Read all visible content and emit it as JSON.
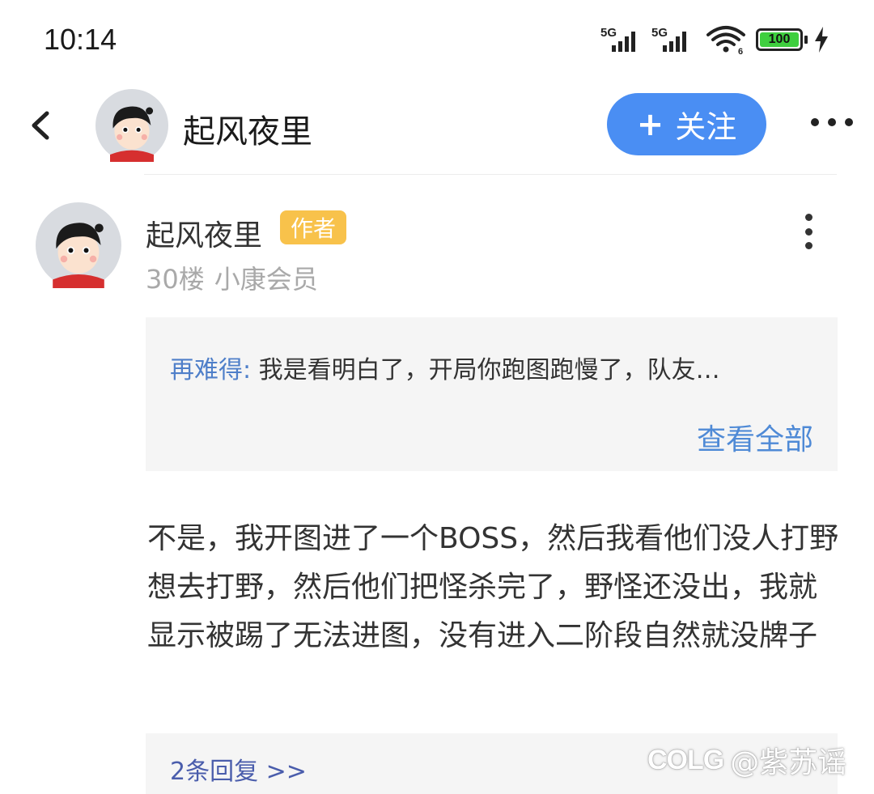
{
  "status_bar": {
    "time": "10:14",
    "signal1_label": "5G",
    "signal2_label": "5G",
    "wifi_label": "6",
    "battery": "100"
  },
  "header": {
    "title": "起风夜里",
    "follow_icon": "+",
    "follow_label": "关注"
  },
  "post": {
    "author": "起风夜里",
    "author_badge": "作者",
    "floor": "30楼",
    "member_level": "小康会员",
    "quote": {
      "author": "再难得:",
      "text": "我是看明白了，开局你跑图跑慢了，队友…",
      "view_all": "查看全部"
    },
    "content": "不是，我开图进了一个BOSS，然后我看他们没人打野想去打野，然后他们把怪杀完了，野怪还没出，我就显示被踢了无法进图，没有进入二阶段自然就没牌子",
    "replies_link": "2条回复 >>"
  },
  "watermark": {
    "logo": "COLG",
    "user": "@紫苏谣"
  },
  "colors": {
    "follow_bg": "#4a8ef3",
    "badge_bg": "#f8c24b",
    "link_blue": "#4f8ad6",
    "quote_author": "#4f7fc9",
    "reply_link": "#4a5dac"
  }
}
